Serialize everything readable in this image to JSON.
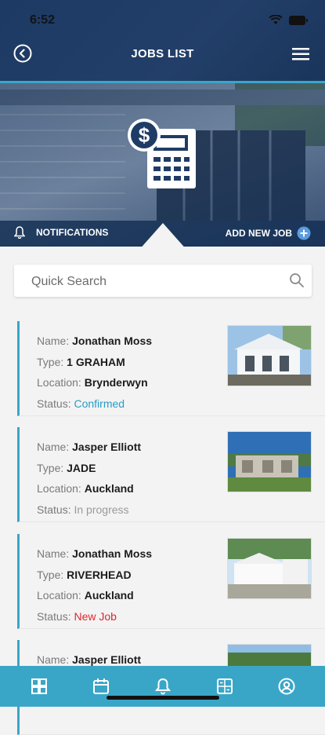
{
  "status_bar": {
    "time": "6:52"
  },
  "header": {
    "title": "JOBS LIST"
  },
  "hero": {
    "notifications_label": "NOTIFICATIONS",
    "add_job_label": "ADD NEW JOB"
  },
  "search": {
    "placeholder": "Quick Search"
  },
  "labels": {
    "name": "Name:",
    "type": "Type:",
    "location": "Location:",
    "status": "Status:"
  },
  "jobs": [
    {
      "name": "Jonathan Moss",
      "type": "1 GRAHAM",
      "location": "Brynderwyn",
      "status": "Confirmed"
    },
    {
      "name": "Jasper Elliott",
      "type": "JADE",
      "location": "Auckland",
      "status": "In progress"
    },
    {
      "name": "Jonathan Moss",
      "type": "RIVERHEAD",
      "location": "Auckland",
      "status": "New Job"
    },
    {
      "name": "Jasper Elliott"
    }
  ],
  "colors": {
    "header": "#1f3c66",
    "accent": "#3aa6c7",
    "confirmed": "#2a9cc4",
    "new_job": "#e0262a"
  },
  "bottom_nav": [
    "dashboard-icon",
    "calendar-icon",
    "bell-icon",
    "calculator-icon",
    "profile-icon"
  ]
}
